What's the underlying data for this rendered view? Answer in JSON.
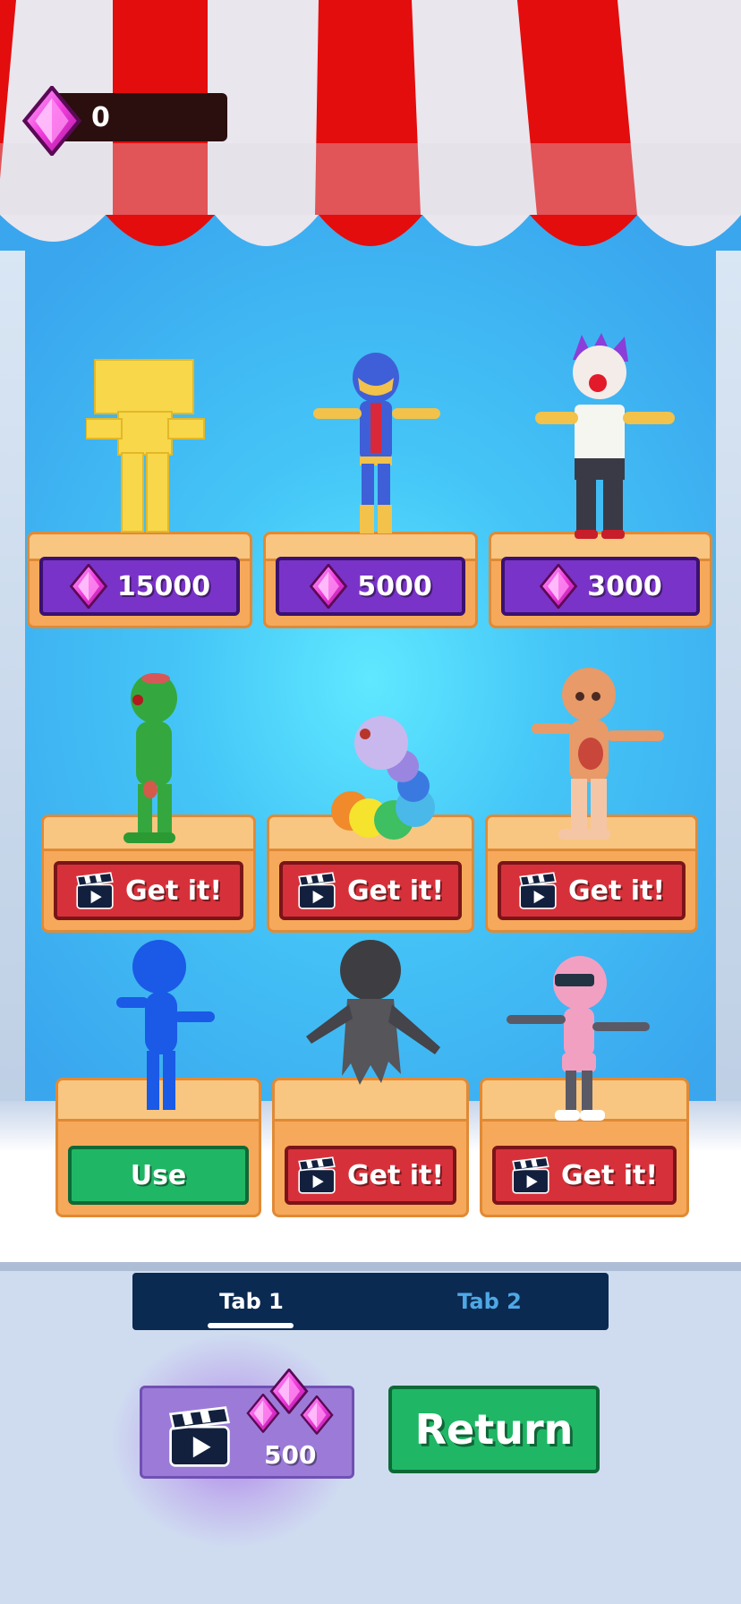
{
  "hud": {
    "gem_count": "0"
  },
  "shop": {
    "row1": [
      {
        "price": "15000",
        "character": "yellow-blocky-robot"
      },
      {
        "price": "5000",
        "character": "blue-superhero"
      },
      {
        "price": "3000",
        "character": "clown"
      }
    ],
    "row2": [
      {
        "action": "Get it!",
        "character": "green-zombie"
      },
      {
        "action": "Get it!",
        "character": "ball-caterpillar"
      },
      {
        "action": "Get it!",
        "character": "orange-skeleton"
      }
    ],
    "row3": [
      {
        "action": "Use",
        "character": "blue-stickman"
      },
      {
        "action": "Get it!",
        "character": "grey-ghost"
      },
      {
        "action": "Get it!",
        "character": "pink-robot"
      }
    ]
  },
  "tabs": [
    {
      "label": "Tab 1",
      "selected": true
    },
    {
      "label": "Tab 2",
      "selected": false
    }
  ],
  "bottom": {
    "ad_reward_amount": "500",
    "return_label": "Return"
  },
  "colors": {
    "price_button": "#7a33c8",
    "ad_button": "#d6313a",
    "use_button": "#1fb765",
    "awning_red": "#e30d0d",
    "tab_bar": "#0b2a52"
  }
}
